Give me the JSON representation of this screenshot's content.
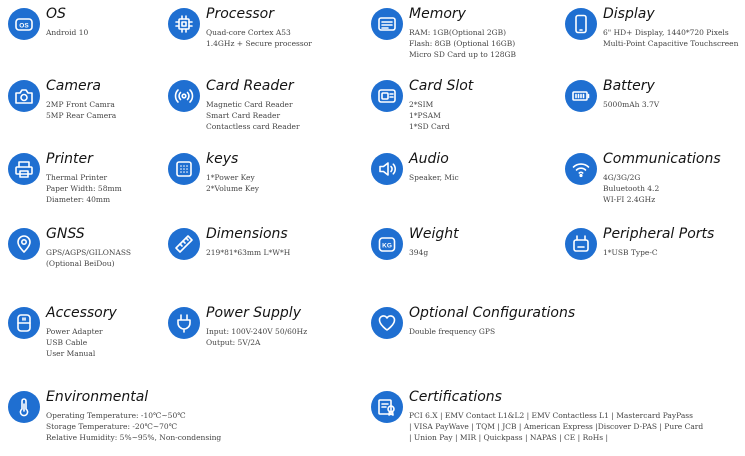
{
  "accent_color": "#1f6fd1",
  "specs": [
    {
      "icon": "os-icon",
      "title": "OS",
      "lines": [
        "Android 10"
      ]
    },
    {
      "icon": "processor-icon",
      "title": "Processor",
      "lines": [
        "Quad-core Cortex A53",
        "1.4GHz + Secure processor"
      ]
    },
    {
      "icon": "memory-icon",
      "title": "Memory",
      "lines": [
        "RAM: 1GB(Optional 2GB)",
        "Flash: 8GB (Optional 16GB)",
        "Micro SD Card up to 128GB"
      ]
    },
    {
      "icon": "display-icon",
      "title": "Display",
      "lines": [
        "6\" HD+ Display, 1440*720 Pixels",
        "Multi-Point Capacitive Touchscreen"
      ]
    },
    {
      "icon": "camera-icon",
      "title": "Camera",
      "lines": [
        "2MP Front Camra",
        "5MP Rear Camera"
      ]
    },
    {
      "icon": "card-reader-icon",
      "title": "Card Reader",
      "lines": [
        "Magnetic Card Reader",
        "Smart Card Reader",
        "Contactless card Reader"
      ]
    },
    {
      "icon": "card-slot-icon",
      "title": "Card Slot",
      "lines": [
        "2*SIM",
        "1*PSAM",
        "1*SD Card"
      ]
    },
    {
      "icon": "battery-icon",
      "title": "Battery",
      "lines": [
        "5000mAh 3.7V"
      ]
    },
    {
      "icon": "printer-icon",
      "title": "Printer",
      "lines": [
        "Thermal Printer",
        "Paper Width: 58mm",
        "Diameter: 40mm"
      ]
    },
    {
      "icon": "keypad-icon",
      "title": "keys",
      "lines": [
        "1*Power Key",
        "2*Volume Key"
      ]
    },
    {
      "icon": "audio-icon",
      "title": "Audio",
      "lines": [
        "Speaker, Mic"
      ]
    },
    {
      "icon": "wifi-icon",
      "title": "Communications",
      "lines": [
        "4G/3G/2G",
        "Buluetooth 4.2",
        "WI-FI 2.4GHz"
      ]
    },
    {
      "icon": "location-pin-icon",
      "title": "GNSS",
      "lines": [
        "GPS/AGPS/GILONASS",
        "(Optional BeiDou)"
      ]
    },
    {
      "icon": "ruler-icon",
      "title": "Dimensions",
      "lines": [
        "219*81*63mm L*W*H"
      ]
    },
    {
      "icon": "weight-icon",
      "title": "Weight",
      "lines": [
        "394g"
      ],
      "icon_text": "KG"
    },
    {
      "icon": "usb-port-icon",
      "title": "Peripheral Ports",
      "lines": [
        "1*USB Type-C"
      ]
    },
    {
      "icon": "power-adapter-icon",
      "title": "Accessory",
      "lines": [
        "Power Adapter",
        "USB Cable",
        "User Manual"
      ]
    },
    {
      "icon": "plug-icon",
      "title": "Power Supply",
      "lines": [
        "Input: 100V-240V 50/60Hz",
        "Output: 5V/2A"
      ]
    },
    {
      "icon": "heart-icon",
      "title": "Optional Configurations",
      "lines": [
        "Double frequency GPS"
      ]
    },
    {
      "icon": "thermometer-icon",
      "title": "Environmental",
      "lines": [
        "Operating Temperature: -10℃~50℃",
        "Storage Temperature: -20℃~70℃",
        "Relative Humidity: 5%~95%, Non-condensing"
      ]
    },
    {
      "icon": "certificate-icon",
      "title": "Certifications",
      "lines": [
        "PCI 6.X | EMV Contact L1&L2 | EMV Contactless L1 | Mastercard PayPass",
        "| VISA PayWave | TQM | JCB | American Express |Discover D-PAS | Pure Card",
        "| Union Pay | MIR | Quickpass  | NAPAS |  CE | RoHs |"
      ]
    }
  ]
}
